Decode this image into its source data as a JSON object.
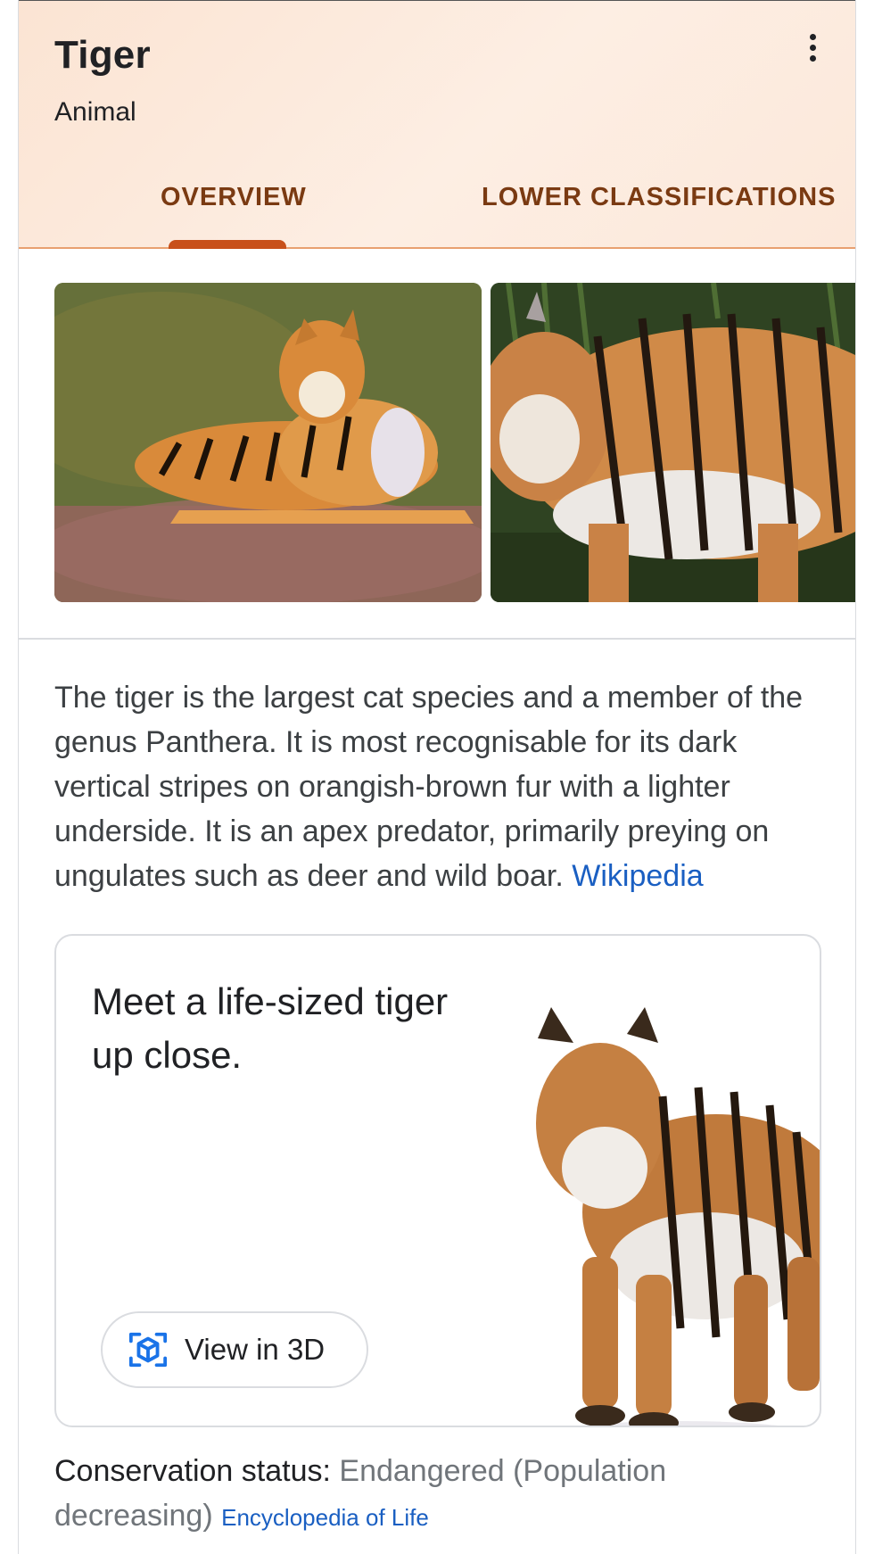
{
  "header": {
    "title": "Tiger",
    "subtitle": "Animal",
    "tabs": [
      {
        "label": "OVERVIEW",
        "selected": true
      },
      {
        "label": "LOWER CLASSIFICATIONS",
        "selected": false
      }
    ],
    "more_icon": "more-vert-icon"
  },
  "images": [
    {
      "alt": "tiger lying on grass"
    },
    {
      "alt": "tiger standing in forest"
    }
  ],
  "description": {
    "text": "The tiger is the largest cat species and a member of the genus Panthera. It is most recognisable for its dark vertical stripes on orangish-brown fur with a lighter underside. It is an apex predator, primarily preying on ungulates such as deer and wild boar. ",
    "source_link": "Wikipedia"
  },
  "promo": {
    "headline": "Meet a life-sized tiger up close.",
    "button_label": "View in 3D",
    "button_icon": "3d-cube-icon"
  },
  "conservation": {
    "label": "Conservation status: ",
    "value": "Endangered (Population decreasing)",
    "source_link": "Encyclopedia of Life"
  },
  "colors": {
    "header_bg": "#fbe4d3",
    "tab_text": "#7a3a12",
    "tab_indicator": "#c8501a",
    "link": "#1a5fc2",
    "icon_blue": "#1a73e8"
  }
}
